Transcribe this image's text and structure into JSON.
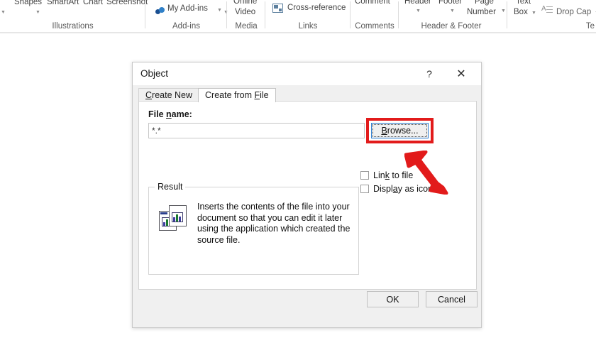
{
  "ribbon": {
    "groups": [
      {
        "name": "illustrations",
        "title": "Illustrations",
        "commands": [
          "Shapes",
          "SmartArt",
          "Chart",
          "Screenshot"
        ]
      },
      {
        "name": "add-ins",
        "title": "Add-ins",
        "commands": [
          "My Add-ins"
        ]
      },
      {
        "name": "media",
        "title": "Media",
        "commands": [
          "Online",
          "Video"
        ]
      },
      {
        "name": "links",
        "title": "Links",
        "commands": [
          "Cross-reference"
        ]
      },
      {
        "name": "comments",
        "title": "Comments",
        "commands": [
          "Comment"
        ]
      },
      {
        "name": "header-footer",
        "title": "Header & Footer",
        "commands": [
          "Header",
          "Footer",
          "Page",
          "Number"
        ]
      },
      {
        "name": "text",
        "title": "Te",
        "commands": [
          "Text",
          "Box",
          "Drop Cap"
        ]
      }
    ],
    "icons": {
      "add_ins": "add-ins-icon",
      "cross_reference": "cross-reference-icon",
      "drop_cap": "drop-cap-icon",
      "dropdown_caret": "chevron-down-icon"
    }
  },
  "dialog": {
    "title": "Object",
    "help_glyph": "?",
    "close_glyph": "✕",
    "tabs": [
      {
        "label": "Create New",
        "accel": "C",
        "selected": false
      },
      {
        "label": "Create from File",
        "accel": "F",
        "selected": true
      }
    ],
    "filename": {
      "label_pre": "File ",
      "label_accel": "n",
      "label_post": "ame:",
      "value": "*.*",
      "placeholder": "*.*"
    },
    "browse": {
      "accel": "B",
      "label_post": "rowse...",
      "highlight_color": "#e21b1b",
      "focus_border_color": "#2f7fd1"
    },
    "checkboxes": [
      {
        "name": "link-to-file",
        "pre": "Lin",
        "accel": "k",
        "post": " to file",
        "checked": false
      },
      {
        "name": "display-as-icon",
        "pre": "Displ",
        "accel": "a",
        "post": "y as icon",
        "checked": false
      }
    ],
    "result": {
      "legend": "Result",
      "icon": "document-chart-icon",
      "text": "Inserts the contents of the file into your document so that you can edit it later using the application which created the source file."
    },
    "footer": {
      "ok_label": "OK",
      "cancel_label": "Cancel"
    }
  },
  "annotations": {
    "arrow": {
      "name": "red-arrow-pointer",
      "color": "#e21b1b",
      "points_to": "browse-button"
    }
  }
}
